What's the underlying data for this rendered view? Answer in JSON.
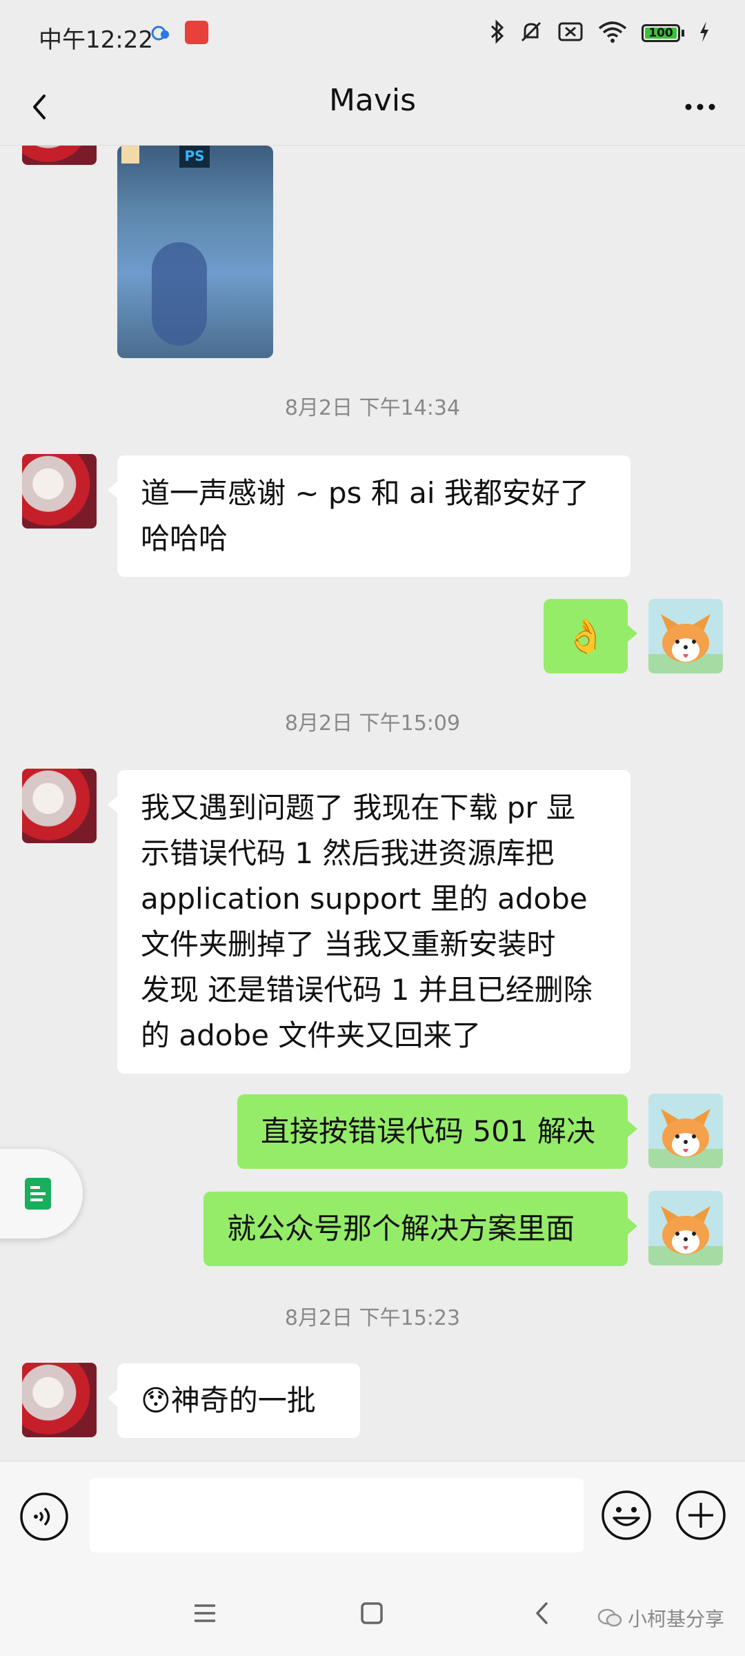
{
  "status_bar": {
    "time": "中午12:22",
    "battery": "100"
  },
  "header": {
    "title": "Mavis"
  },
  "messages": {
    "ts1": "8月2日 下午14:34",
    "m1_line1": "道一声感谢 ~ ps 和 ai 我都安好了",
    "m1_line2": "哈哈哈",
    "m2_emoji": "👌",
    "ts2": "8月2日 下午15:09",
    "m3_lines": [
      "我又遇到问题了 我现在下载 pr 显",
      "示错误代码 1 然后我进资源库把",
      "application support 里的 adobe",
      "文件夹删掉了 当我又重新安装时",
      "发现 还是错误代码 1 并且已经删除",
      "的 adobe 文件夹又回来了"
    ],
    "m4": "直接按错误代码 501 解决",
    "m5": "就公众号那个解决方案里面",
    "ts3": "8月2日 下午15:23",
    "m6_emoji": "😯",
    "m6_text": "神奇的一批"
  },
  "image_thumbnail": {
    "label": "PS"
  },
  "watermark": "小柯基分享",
  "icons": [
    "back-arrow-icon",
    "more-dots-icon",
    "voice-icon",
    "emoji-icon",
    "plus-icon",
    "menu-nav-icon",
    "home-nav-icon",
    "back-nav-icon",
    "document-icon",
    "bluetooth-icon",
    "mute-icon",
    "no-sim-icon",
    "wifi-icon",
    "battery-icon",
    "charging-icon"
  ]
}
